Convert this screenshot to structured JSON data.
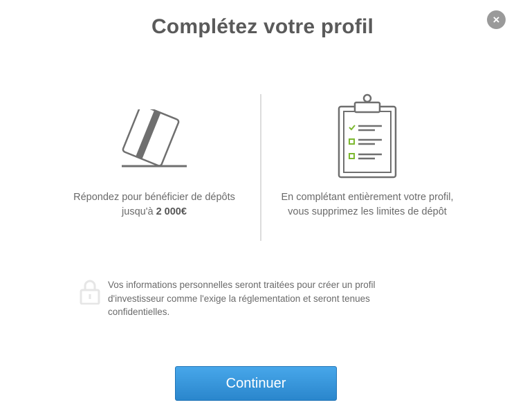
{
  "dialog": {
    "title": "Complétez votre profil",
    "close_label": "×"
  },
  "left_column": {
    "icon": "credit-card-icon",
    "line1": "Répondez pour bénéficier de dépôts",
    "line2_prefix": "jusqu'à ",
    "line2_amount": "2 000€"
  },
  "right_column": {
    "icon": "clipboard-checklist-icon",
    "text": "En complétant entièrement votre profil, vous supprimez les limites de dépôt"
  },
  "privacy": {
    "icon": "lock-icon",
    "text": "Vos informations personnelles seront traitées pour créer un profil d'investisseur comme l'exige la réglementation et seront tenues confidentielles."
  },
  "actions": {
    "continue_label": "Continuer"
  },
  "colors": {
    "accent": "#3597dd",
    "check_green": "#7cb82f",
    "icon_gray": "#6f6f6f"
  }
}
